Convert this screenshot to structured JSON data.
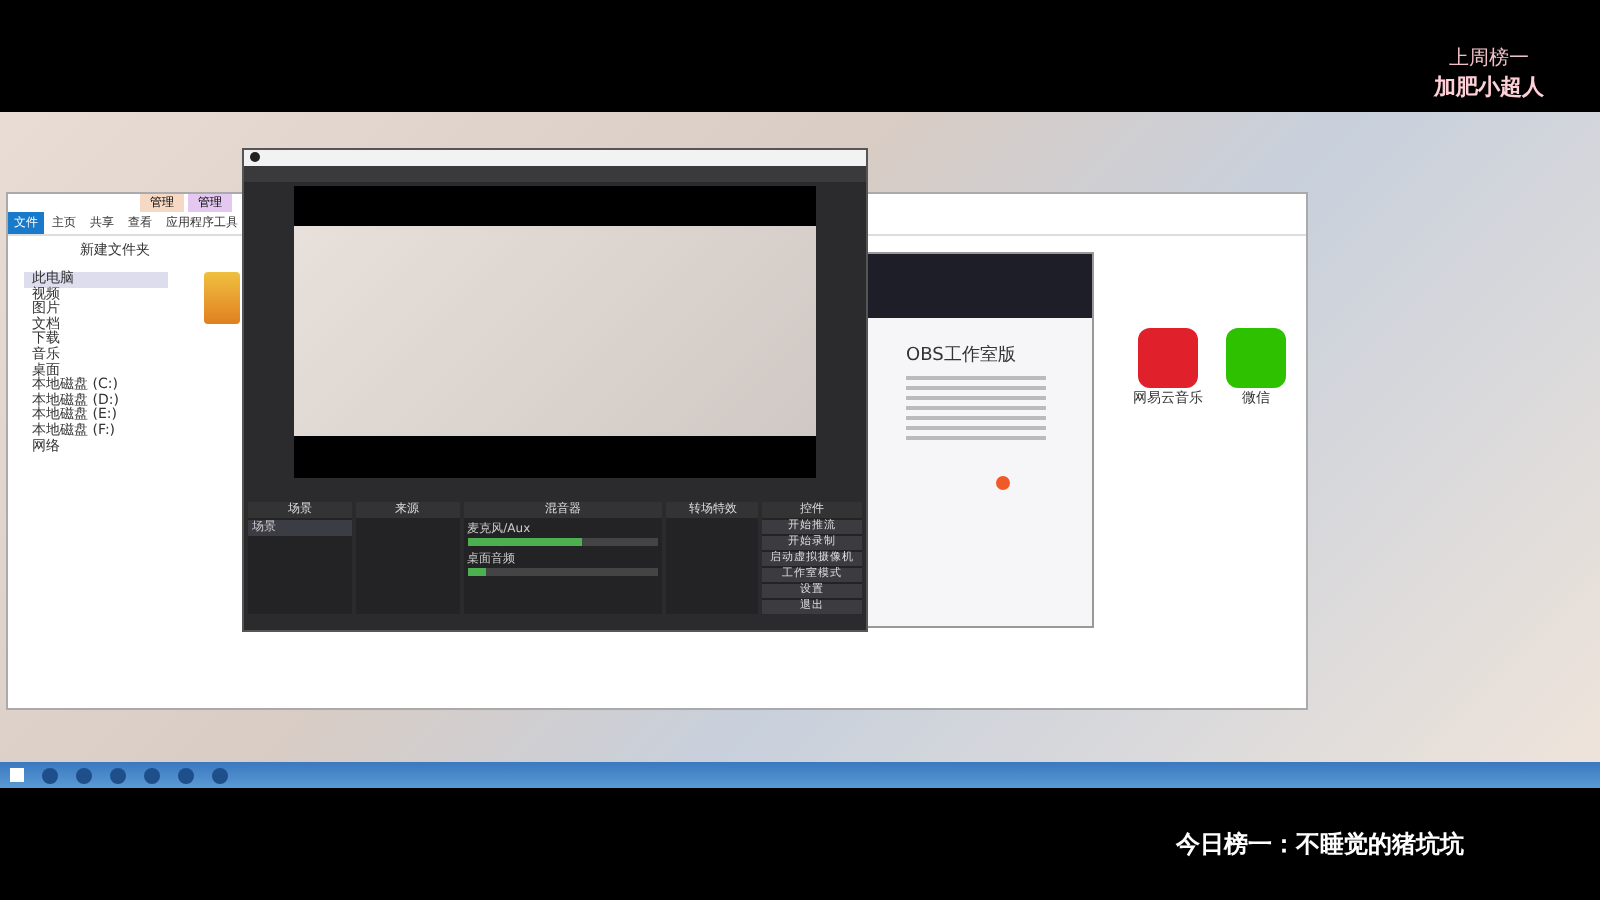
{
  "overlay": {
    "last_week_label": "上周榜一",
    "last_week_name": "加肥小超人",
    "today_caption": "今日榜一：不睡觉的猪坑坑"
  },
  "explorer": {
    "tabs": [
      {
        "label": "管理",
        "selected": false
      },
      {
        "label": "管理",
        "selected": true
      }
    ],
    "ribbon": [
      {
        "label": "文件",
        "selected": true
      },
      {
        "label": "主页",
        "selected": false
      },
      {
        "label": "共享",
        "selected": false
      },
      {
        "label": "查看",
        "selected": false
      },
      {
        "label": "应用程序工具",
        "selected": false
      }
    ],
    "path": "新建文件夹",
    "nav": [
      {
        "label": "此电脑",
        "selected": true
      },
      {
        "label": "视频",
        "selected": false
      },
      {
        "label": "图片",
        "selected": false
      },
      {
        "label": "文档",
        "selected": false
      },
      {
        "label": "下载",
        "selected": false
      },
      {
        "label": "音乐",
        "selected": false
      },
      {
        "label": "桌面",
        "selected": false
      },
      {
        "label": "本地磁盘 (C:)",
        "selected": false
      },
      {
        "label": "本地磁盘 (D:)",
        "selected": false
      },
      {
        "label": "本地磁盘 (E:)",
        "selected": false
      },
      {
        "label": "本地磁盘 (F:)",
        "selected": false
      },
      {
        "label": "网络",
        "selected": false
      }
    ],
    "apps": [
      {
        "label": "网易云音乐",
        "color": "#e0202a"
      },
      {
        "label": "微信",
        "color": "#2dc100"
      }
    ]
  },
  "obs": {
    "docks": [
      "场景",
      "来源",
      "混音器",
      "转场特效",
      "控件"
    ],
    "scenes": [
      {
        "label": "场景",
        "selected": true
      }
    ],
    "mixer": [
      {
        "name": "麦克风/Aux",
        "level": 0.6
      },
      {
        "name": "桌面音频",
        "level": 0.1
      }
    ],
    "controls": [
      "开始推流",
      "开始录制",
      "启动虚拟摄像机",
      "工作室模式",
      "设置",
      "退出"
    ]
  },
  "installer": {
    "title": "OBS工作室版",
    "option": {
      "selected": true
    }
  }
}
